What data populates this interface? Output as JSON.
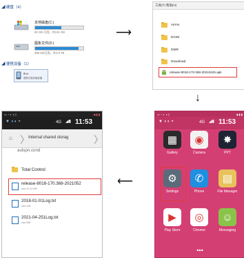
{
  "explorer": {
    "section_drives": "◢ 硬盘（4）",
    "drive_c": {
      "name": "本地磁盘(C:)",
      "free_text": "60 GB 可用，共131 GB",
      "fill_fraction": 0.54
    },
    "drive_d": {
      "name": "图象文件(D:)",
      "free_text": "386 GB可用，共3.8 TB",
      "fill_fraction": 0.9
    },
    "section_portable": "◢ 便携设备（1）",
    "device": {
      "name": "Ⅲ III",
      "sub": "便携式媒体播放器"
    }
  },
  "folder_view": {
    "menubar": "工具(T)  帮助(H)",
    "folders": [
      "Airms",
      "DCIM",
      "DMR",
      "Download"
    ],
    "apk_file": "release-8018-170.368-20210425.apk"
  },
  "phone_home": {
    "status_right": "◀ ▮ ▮",
    "status_left": "▭ ◔ ◐ ◑ ▯",
    "time": "11:53",
    "network": "4G",
    "apps": [
      {
        "label": "Gallery",
        "color": "#2a2a2a",
        "glyph": "▦"
      },
      {
        "label": "Camera",
        "color": "#f2f2f2",
        "glyph": "◉"
      },
      {
        "label": "PPT",
        "color": "#1e2433",
        "glyph": "✸"
      },
      {
        "label": "Settings",
        "color": "#5b6b7a",
        "glyph": "⚙"
      },
      {
        "label": "Phone",
        "color": "#1f8fe0",
        "glyph": "✆"
      },
      {
        "label": "File Manager",
        "color": "#e8c25a",
        "glyph": "▤"
      },
      {
        "label": "Play Store",
        "color": "#ffffff",
        "glyph": "▶"
      },
      {
        "label": "Chrome",
        "color": "#ffffff",
        "glyph": "◎"
      },
      {
        "label": "Messaging",
        "color": "#8bc34a",
        "glyph": "☺"
      }
    ],
    "page_dots": "•••"
  },
  "file_picker": {
    "time": "11:53",
    "network": "4G",
    "breadcrumb": "Internal shared storag",
    "partial_item": "aulspn.cond",
    "items": [
      {
        "title": "Total Control",
        "sub": ""
      },
      {
        "title": "release-8018-170.368-2021052",
        "sub": "size 24.14 MB"
      },
      {
        "title": "2018-01-01Log.txt",
        "sub": "size 438"
      },
      {
        "title": "2021-04-251Log.txt",
        "sub": "size 698"
      }
    ]
  },
  "arrows": {
    "right": "⟶",
    "down": "↓",
    "left": "⟵"
  },
  "colors": {
    "highlight": "#e03b3b",
    "phone_bg": "#d43f73",
    "accent_blue": "#2a8bd4"
  }
}
